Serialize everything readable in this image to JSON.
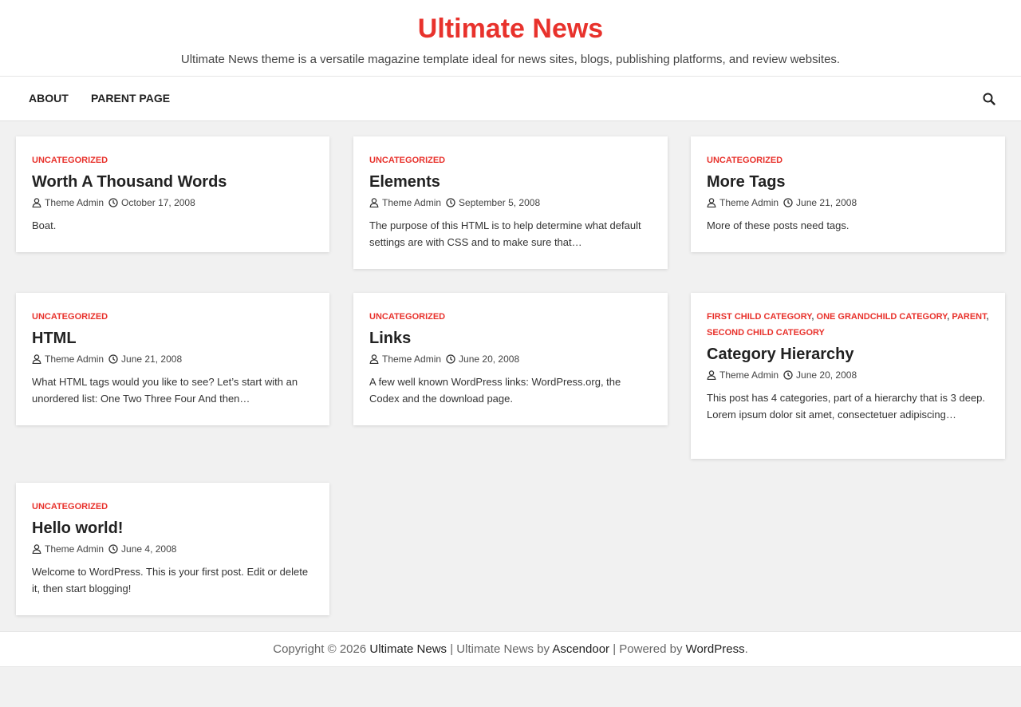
{
  "site": {
    "title": "Ultimate News",
    "description": "Ultimate News theme is a versatile magazine template ideal for news sites, blogs, publishing platforms, and review websites."
  },
  "nav": {
    "items": [
      {
        "label": "ABOUT"
      },
      {
        "label": "PARENT PAGE"
      }
    ],
    "search_icon": "search-icon"
  },
  "posts": [
    {
      "categories": [
        "UNCATEGORIZED"
      ],
      "title": "Worth A Thousand Words",
      "author": "Theme Admin",
      "date": "October 17, 2008",
      "excerpt": "Boat."
    },
    {
      "categories": [
        "UNCATEGORIZED"
      ],
      "title": "Elements",
      "author": "Theme Admin",
      "date": "September 5, 2008",
      "excerpt": "The purpose of this HTML is to help determine what default settings are with CSS and to make sure that…"
    },
    {
      "categories": [
        "UNCATEGORIZED"
      ],
      "title": "More Tags",
      "author": "Theme Admin",
      "date": "June 21, 2008",
      "excerpt": "More of these posts need tags."
    },
    {
      "categories": [
        "UNCATEGORIZED"
      ],
      "title": "HTML",
      "author": "Theme Admin",
      "date": "June 21, 2008",
      "excerpt": "What HTML tags would you like to see? Let’s start with an unordered list: One Two Three Four And then…"
    },
    {
      "categories": [
        "UNCATEGORIZED"
      ],
      "title": "Links",
      "author": "Theme Admin",
      "date": "June 20, 2008",
      "excerpt": "A few well known WordPress links: WordPress.org, the Codex and the download page."
    },
    {
      "categories": [
        "FIRST CHILD CATEGORY",
        "ONE GRANDCHILD CATEGORY",
        "PARENT",
        "SECOND CHILD CATEGORY"
      ],
      "separator": ",",
      "title": "Category Hierarchy",
      "author": "Theme Admin",
      "date": "June 20, 2008",
      "excerpt": "This post has 4 categories, part of a hierarchy that is 3 deep. Lorem ipsum dolor sit amet, consectetuer adipiscing…"
    },
    {
      "categories": [
        "UNCATEGORIZED"
      ],
      "title": "Hello world!",
      "author": "Theme Admin",
      "date": "June 4, 2008",
      "excerpt": "Welcome to WordPress. This is your first post. Edit or delete it, then start blogging!"
    }
  ],
  "footer": {
    "copyright": "Copyright © 2026",
    "site_link": "Ultimate News",
    "sep1": " | Ultimate News by ",
    "theme_author": "Ascendoor",
    "sep2": " | Powered by ",
    "platform": "WordPress",
    "end": "."
  },
  "colors": {
    "accent": "#e8322c",
    "background": "#f1f1f1",
    "card": "#ffffff"
  }
}
